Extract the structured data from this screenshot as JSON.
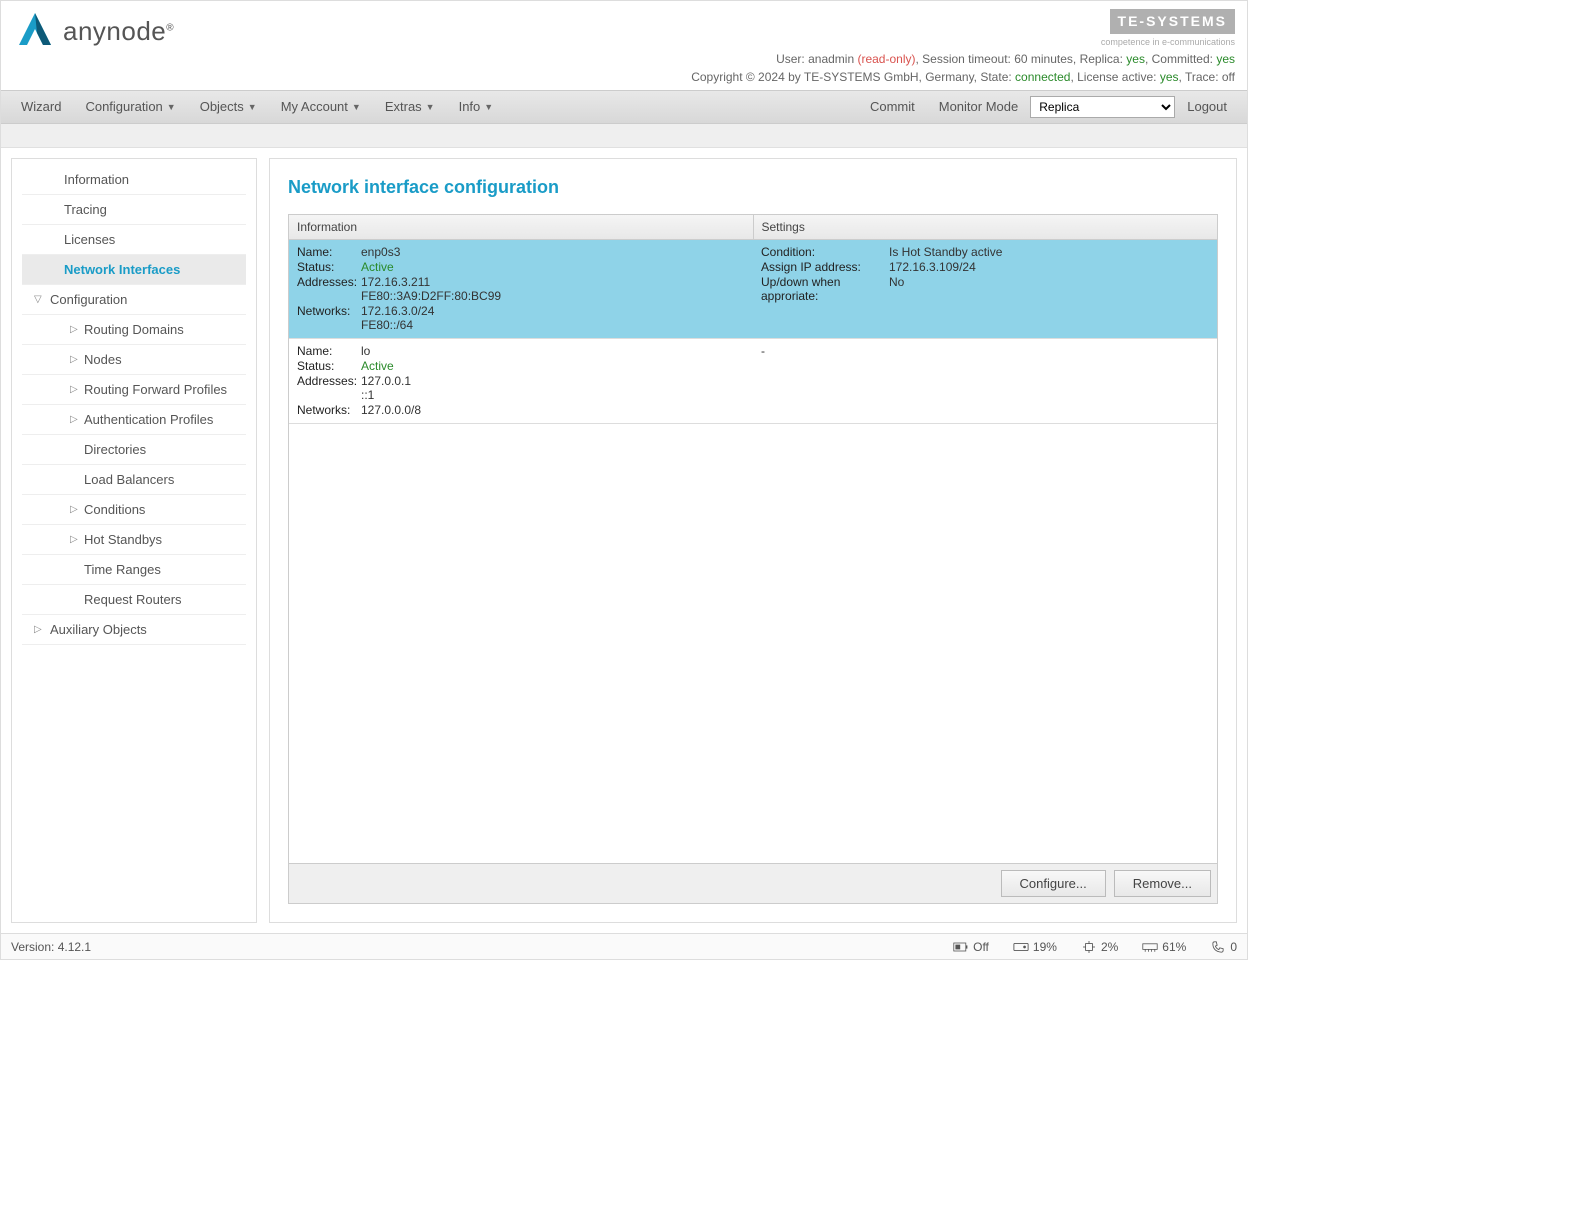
{
  "header": {
    "brand": "anynode",
    "reg": "®",
    "vendor": "TE-SYSTEMS",
    "vendor_sub": "competence in e-communications",
    "status_line_prefix": "User: ",
    "user": "anadmin",
    "readonly": " (read-only)",
    "status_rest1": ", Session timeout: 60 minutes, Replica: ",
    "replica": "yes",
    "status_rest2": ", Committed: ",
    "committed": "yes",
    "copyright_prefix": "Copyright © 2024 by TE-SYSTEMS GmbH, Germany, State: ",
    "state": "connected",
    "copyright_mid": ", License active: ",
    "license": "yes",
    "copyright_suffix": ", Trace: off"
  },
  "nav": {
    "wizard": "Wizard",
    "configuration": "Configuration",
    "objects": "Objects",
    "myaccount": "My Account",
    "extras": "Extras",
    "info": "Info",
    "commit": "Commit",
    "monitor": "Monitor Mode",
    "select_value": "Replica",
    "logout": "Logout"
  },
  "sidebar": {
    "information": "Information",
    "tracing": "Tracing",
    "licenses": "Licenses",
    "network_interfaces": "Network Interfaces",
    "configuration": "Configuration",
    "routing_domains": "Routing Domains",
    "nodes": "Nodes",
    "routing_forward": "Routing Forward Profiles",
    "auth_profiles": "Authentication Profiles",
    "directories": "Directories",
    "load_balancers": "Load Balancers",
    "conditions": "Conditions",
    "hot_standbys": "Hot Standbys",
    "time_ranges": "Time Ranges",
    "request_routers": "Request Routers",
    "auxiliary": "Auxiliary Objects"
  },
  "main": {
    "title": "Network interface configuration",
    "col_info": "Information",
    "col_settings": "Settings",
    "labels": {
      "name": "Name:",
      "status": "Status:",
      "addresses": "Addresses:",
      "networks": "Networks:",
      "condition": "Condition:",
      "assign_ip": "Assign IP address:",
      "updown": "Up/down when approriate:"
    },
    "rows": [
      {
        "name": "enp0s3",
        "status": "Active",
        "addr1": "172.16.3.211",
        "addr2": "FE80::3A9:D2FF:80:BC99",
        "net1": "172.16.3.0/24",
        "net2": "FE80::/64",
        "condition": "Is Hot Standby active",
        "assign_ip": "172.16.3.109/24",
        "updown": "No"
      },
      {
        "name": "lo",
        "status": "Active",
        "addr1": "127.0.0.1",
        "addr2": "::1",
        "net1": "127.0.0.0/8",
        "settings_dash": "-"
      }
    ],
    "configure_btn": "Configure...",
    "remove_btn": "Remove..."
  },
  "footer": {
    "version_label": "Version:",
    "version": "4.12.1",
    "off": "Off",
    "disk": "19%",
    "cpu": "2%",
    "mem": "61%",
    "calls": "0"
  }
}
